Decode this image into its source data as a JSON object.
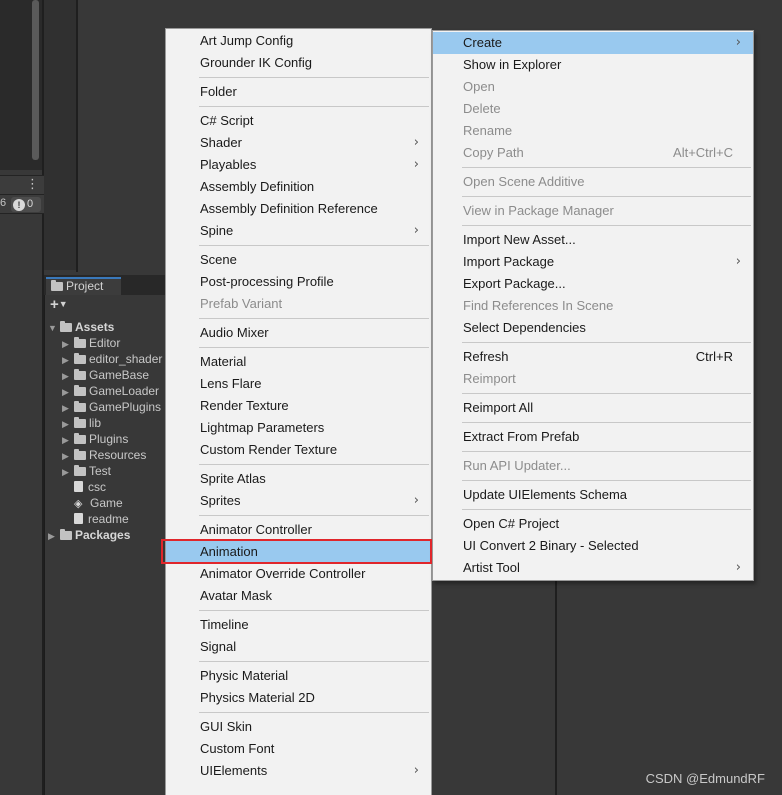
{
  "console": {
    "cut_count": "6",
    "warning_count": "0"
  },
  "project": {
    "tab_label": "Project",
    "add_button": "+",
    "tree": [
      {
        "label": "Assets",
        "icon": "folder-open-icon",
        "expandable": true,
        "expanded": true,
        "bold": true
      },
      {
        "label": "Editor",
        "icon": "folder-icon",
        "expandable": true
      },
      {
        "label": "editor_shader",
        "icon": "folder-icon",
        "expandable": true
      },
      {
        "label": "GameBase",
        "icon": "folder-icon",
        "expandable": true
      },
      {
        "label": "GameLoader",
        "icon": "folder-icon",
        "expandable": true
      },
      {
        "label": "GamePlugins",
        "icon": "folder-icon",
        "expandable": true
      },
      {
        "label": "lib",
        "icon": "folder-icon",
        "expandable": true
      },
      {
        "label": "Plugins",
        "icon": "folder-icon",
        "expandable": true
      },
      {
        "label": "Resources",
        "icon": "folder-icon",
        "expandable": true
      },
      {
        "label": "Test",
        "icon": "folder-icon",
        "expandable": true
      },
      {
        "label": "csc",
        "icon": "file-icon",
        "expandable": false
      },
      {
        "label": "Game",
        "icon": "unity-scene-icon",
        "expandable": false
      },
      {
        "label": "readme",
        "icon": "file-icon",
        "expandable": false
      },
      {
        "label": "Packages",
        "icon": "folder-icon",
        "expandable": true,
        "bold": true
      }
    ]
  },
  "create_submenu": {
    "groups": [
      [
        {
          "label": "Art Jump Config"
        },
        {
          "label": "Grounder IK Config"
        }
      ],
      [
        {
          "label": "Folder"
        }
      ],
      [
        {
          "label": "C# Script"
        },
        {
          "label": "Shader",
          "submenu": true
        },
        {
          "label": "Playables",
          "submenu": true
        },
        {
          "label": "Assembly Definition"
        },
        {
          "label": "Assembly Definition Reference"
        },
        {
          "label": "Spine",
          "submenu": true
        }
      ],
      [
        {
          "label": "Scene"
        },
        {
          "label": "Post-processing Profile"
        },
        {
          "label": "Prefab Variant",
          "disabled": true
        }
      ],
      [
        {
          "label": "Audio Mixer"
        }
      ],
      [
        {
          "label": "Material"
        },
        {
          "label": "Lens Flare"
        },
        {
          "label": "Render Texture"
        },
        {
          "label": "Lightmap Parameters"
        },
        {
          "label": "Custom Render Texture"
        }
      ],
      [
        {
          "label": "Sprite Atlas"
        },
        {
          "label": "Sprites",
          "submenu": true
        }
      ],
      [
        {
          "label": "Animator Controller"
        },
        {
          "label": "Animation",
          "highlighted": true
        },
        {
          "label": "Animator Override Controller"
        },
        {
          "label": "Avatar Mask"
        }
      ],
      [
        {
          "label": "Timeline"
        },
        {
          "label": "Signal"
        }
      ],
      [
        {
          "label": "Physic Material"
        },
        {
          "label": "Physics Material 2D"
        }
      ],
      [
        {
          "label": "GUI Skin"
        },
        {
          "label": "Custom Font"
        },
        {
          "label": "UIElements",
          "submenu": true
        }
      ]
    ]
  },
  "context_menu": {
    "groups": [
      [
        {
          "label": "Create",
          "submenu": true,
          "highlighted": true
        },
        {
          "label": "Show in Explorer"
        },
        {
          "label": "Open",
          "disabled": true
        },
        {
          "label": "Delete",
          "disabled": true
        },
        {
          "label": "Rename",
          "disabled": true
        },
        {
          "label": "Copy Path",
          "disabled": true,
          "shortcut": "Alt+Ctrl+C"
        }
      ],
      [
        {
          "label": "Open Scene Additive",
          "disabled": true
        }
      ],
      [
        {
          "label": "View in Package Manager",
          "disabled": true
        }
      ],
      [
        {
          "label": "Import New Asset..."
        },
        {
          "label": "Import Package",
          "submenu": true
        },
        {
          "label": "Export Package..."
        },
        {
          "label": "Find References In Scene",
          "disabled": true
        },
        {
          "label": "Select Dependencies"
        }
      ],
      [
        {
          "label": "Refresh",
          "shortcut": "Ctrl+R"
        },
        {
          "label": "Reimport",
          "disabled": true
        }
      ],
      [
        {
          "label": "Reimport All"
        }
      ],
      [
        {
          "label": "Extract From Prefab"
        }
      ],
      [
        {
          "label": "Run API Updater...",
          "disabled": true
        }
      ],
      [
        {
          "label": "Update UIElements Schema"
        }
      ],
      [
        {
          "label": "Open C# Project"
        },
        {
          "label": "UI Convert 2 Binary - Selected"
        },
        {
          "label": "Artist Tool",
          "submenu": true
        }
      ]
    ]
  },
  "icons": {
    "submenu_arrow": "›",
    "expand_arrow": "▶",
    "collapse_arrow": "▼"
  },
  "watermark": "CSDN @EdmundRF"
}
